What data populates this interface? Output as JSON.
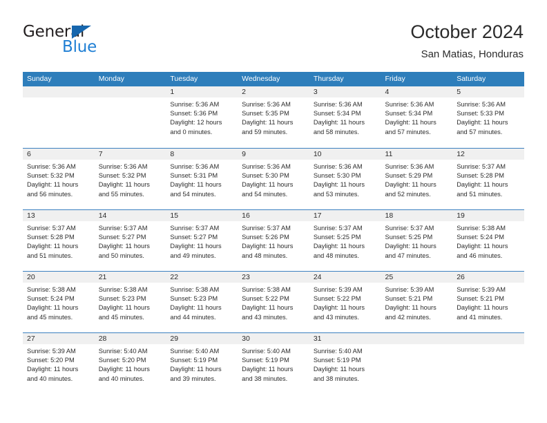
{
  "logo": {
    "word_one": "General",
    "word_two": "Blue",
    "triangle_color": "#1666ad",
    "blue_color": "#1f7fd4"
  },
  "header": {
    "title": "October 2024",
    "subtitle": "San Matias, Honduras"
  },
  "theme": {
    "header_blue": "#2e7ebb",
    "row_divider": "#3a7fbf",
    "daynum_bg": "#f0f0f0"
  },
  "weekdays": [
    "Sunday",
    "Monday",
    "Tuesday",
    "Wednesday",
    "Thursday",
    "Friday",
    "Saturday"
  ],
  "weeks": [
    [
      {
        "day": "",
        "lines": []
      },
      {
        "day": "",
        "lines": []
      },
      {
        "day": "1",
        "lines": [
          "Sunrise: 5:36 AM",
          "Sunset: 5:36 PM",
          "Daylight: 12 hours",
          "and 0 minutes."
        ]
      },
      {
        "day": "2",
        "lines": [
          "Sunrise: 5:36 AM",
          "Sunset: 5:35 PM",
          "Daylight: 11 hours",
          "and 59 minutes."
        ]
      },
      {
        "day": "3",
        "lines": [
          "Sunrise: 5:36 AM",
          "Sunset: 5:34 PM",
          "Daylight: 11 hours",
          "and 58 minutes."
        ]
      },
      {
        "day": "4",
        "lines": [
          "Sunrise: 5:36 AM",
          "Sunset: 5:34 PM",
          "Daylight: 11 hours",
          "and 57 minutes."
        ]
      },
      {
        "day": "5",
        "lines": [
          "Sunrise: 5:36 AM",
          "Sunset: 5:33 PM",
          "Daylight: 11 hours",
          "and 57 minutes."
        ]
      }
    ],
    [
      {
        "day": "6",
        "lines": [
          "Sunrise: 5:36 AM",
          "Sunset: 5:32 PM",
          "Daylight: 11 hours",
          "and 56 minutes."
        ]
      },
      {
        "day": "7",
        "lines": [
          "Sunrise: 5:36 AM",
          "Sunset: 5:32 PM",
          "Daylight: 11 hours",
          "and 55 minutes."
        ]
      },
      {
        "day": "8",
        "lines": [
          "Sunrise: 5:36 AM",
          "Sunset: 5:31 PM",
          "Daylight: 11 hours",
          "and 54 minutes."
        ]
      },
      {
        "day": "9",
        "lines": [
          "Sunrise: 5:36 AM",
          "Sunset: 5:30 PM",
          "Daylight: 11 hours",
          "and 54 minutes."
        ]
      },
      {
        "day": "10",
        "lines": [
          "Sunrise: 5:36 AM",
          "Sunset: 5:30 PM",
          "Daylight: 11 hours",
          "and 53 minutes."
        ]
      },
      {
        "day": "11",
        "lines": [
          "Sunrise: 5:36 AM",
          "Sunset: 5:29 PM",
          "Daylight: 11 hours",
          "and 52 minutes."
        ]
      },
      {
        "day": "12",
        "lines": [
          "Sunrise: 5:37 AM",
          "Sunset: 5:28 PM",
          "Daylight: 11 hours",
          "and 51 minutes."
        ]
      }
    ],
    [
      {
        "day": "13",
        "lines": [
          "Sunrise: 5:37 AM",
          "Sunset: 5:28 PM",
          "Daylight: 11 hours",
          "and 51 minutes."
        ]
      },
      {
        "day": "14",
        "lines": [
          "Sunrise: 5:37 AM",
          "Sunset: 5:27 PM",
          "Daylight: 11 hours",
          "and 50 minutes."
        ]
      },
      {
        "day": "15",
        "lines": [
          "Sunrise: 5:37 AM",
          "Sunset: 5:27 PM",
          "Daylight: 11 hours",
          "and 49 minutes."
        ]
      },
      {
        "day": "16",
        "lines": [
          "Sunrise: 5:37 AM",
          "Sunset: 5:26 PM",
          "Daylight: 11 hours",
          "and 48 minutes."
        ]
      },
      {
        "day": "17",
        "lines": [
          "Sunrise: 5:37 AM",
          "Sunset: 5:25 PM",
          "Daylight: 11 hours",
          "and 48 minutes."
        ]
      },
      {
        "day": "18",
        "lines": [
          "Sunrise: 5:37 AM",
          "Sunset: 5:25 PM",
          "Daylight: 11 hours",
          "and 47 minutes."
        ]
      },
      {
        "day": "19",
        "lines": [
          "Sunrise: 5:38 AM",
          "Sunset: 5:24 PM",
          "Daylight: 11 hours",
          "and 46 minutes."
        ]
      }
    ],
    [
      {
        "day": "20",
        "lines": [
          "Sunrise: 5:38 AM",
          "Sunset: 5:24 PM",
          "Daylight: 11 hours",
          "and 45 minutes."
        ]
      },
      {
        "day": "21",
        "lines": [
          "Sunrise: 5:38 AM",
          "Sunset: 5:23 PM",
          "Daylight: 11 hours",
          "and 45 minutes."
        ]
      },
      {
        "day": "22",
        "lines": [
          "Sunrise: 5:38 AM",
          "Sunset: 5:23 PM",
          "Daylight: 11 hours",
          "and 44 minutes."
        ]
      },
      {
        "day": "23",
        "lines": [
          "Sunrise: 5:38 AM",
          "Sunset: 5:22 PM",
          "Daylight: 11 hours",
          "and 43 minutes."
        ]
      },
      {
        "day": "24",
        "lines": [
          "Sunrise: 5:39 AM",
          "Sunset: 5:22 PM",
          "Daylight: 11 hours",
          "and 43 minutes."
        ]
      },
      {
        "day": "25",
        "lines": [
          "Sunrise: 5:39 AM",
          "Sunset: 5:21 PM",
          "Daylight: 11 hours",
          "and 42 minutes."
        ]
      },
      {
        "day": "26",
        "lines": [
          "Sunrise: 5:39 AM",
          "Sunset: 5:21 PM",
          "Daylight: 11 hours",
          "and 41 minutes."
        ]
      }
    ],
    [
      {
        "day": "27",
        "lines": [
          "Sunrise: 5:39 AM",
          "Sunset: 5:20 PM",
          "Daylight: 11 hours",
          "and 40 minutes."
        ]
      },
      {
        "day": "28",
        "lines": [
          "Sunrise: 5:40 AM",
          "Sunset: 5:20 PM",
          "Daylight: 11 hours",
          "and 40 minutes."
        ]
      },
      {
        "day": "29",
        "lines": [
          "Sunrise: 5:40 AM",
          "Sunset: 5:19 PM",
          "Daylight: 11 hours",
          "and 39 minutes."
        ]
      },
      {
        "day": "30",
        "lines": [
          "Sunrise: 5:40 AM",
          "Sunset: 5:19 PM",
          "Daylight: 11 hours",
          "and 38 minutes."
        ]
      },
      {
        "day": "31",
        "lines": [
          "Sunrise: 5:40 AM",
          "Sunset: 5:19 PM",
          "Daylight: 11 hours",
          "and 38 minutes."
        ]
      },
      {
        "day": "",
        "lines": []
      },
      {
        "day": "",
        "lines": []
      }
    ]
  ]
}
